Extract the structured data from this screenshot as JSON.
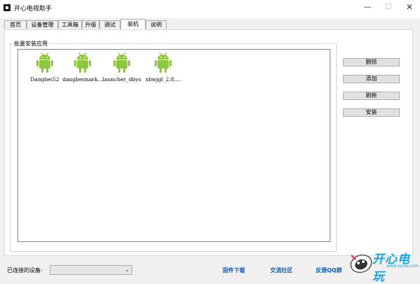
{
  "window": {
    "title": "开心电视助手",
    "minimize": "—",
    "maximize": "☐",
    "close": "✕"
  },
  "tabs": [
    {
      "label": "首页",
      "active": false
    },
    {
      "label": "设备管理",
      "active": false
    },
    {
      "label": "工具箱",
      "active": false
    },
    {
      "label": "升级",
      "active": false
    },
    {
      "label": "调试",
      "active": false
    },
    {
      "label": "装机",
      "active": true
    },
    {
      "label": "说明",
      "active": false
    }
  ],
  "group": {
    "title": "批量安装应用",
    "apps": [
      {
        "label": "Dangbei52",
        "icon": "android-icon"
      },
      {
        "label": "dangbeimark...",
        "icon": "android-icon"
      },
      {
        "label": "launcher_dbys",
        "icon": "android-icon"
      },
      {
        "label": "xbwjgl_2.8....",
        "icon": "android-icon"
      }
    ]
  },
  "actions": {
    "delete": "删除",
    "add": "添加",
    "refresh": "刷新",
    "install": "安装"
  },
  "status": {
    "connected_label": "已连接的设备:",
    "device_selected": ""
  },
  "links": {
    "firmware": "固件下载",
    "community": "交流社区",
    "feedback": "反馈QQ群"
  },
  "brand": {
    "logo_text": "开心电玩",
    "logo_url_text": "www.kxdw.com",
    "accent": "#19a3e0",
    "link_color": "#0b5eb8",
    "android_green": "#8dc63f"
  }
}
